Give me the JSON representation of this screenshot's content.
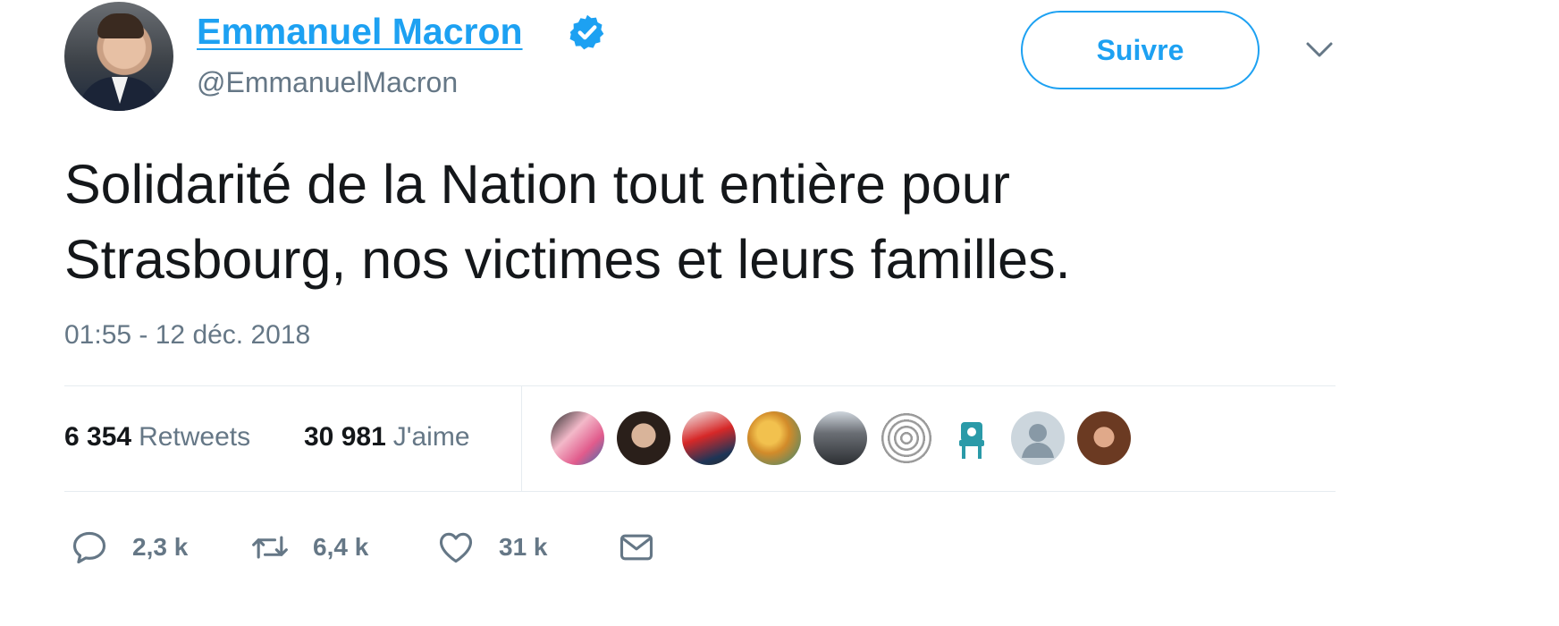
{
  "header": {
    "name": "Emmanuel Macron",
    "handle": "@EmmanuelMacron",
    "follow_label": "Suivre",
    "accent_color": "#1da1f2"
  },
  "tweet": {
    "text_line1": "Solidarité de la Nation tout entière pour",
    "text_line2": "Strasbourg, nos victimes et leurs familles.",
    "timestamp": "01:55 - 12 déc. 2018"
  },
  "stats": {
    "retweets_count": "6 354",
    "retweets_label": "Retweets",
    "likes_count": "30 981",
    "likes_label": "J'aime"
  },
  "likers": [
    "avatar-1",
    "avatar-2",
    "avatar-3",
    "avatar-4",
    "avatar-5",
    "avatar-6",
    "avatar-7",
    "avatar-8",
    "avatar-9"
  ],
  "actions": {
    "reply_count": "2,3 k",
    "retweet_count": "6,4 k",
    "like_count": "31 k"
  },
  "icons": [
    "verified-badge-icon",
    "chevron-down-icon",
    "reply-icon",
    "retweet-icon",
    "heart-icon",
    "mail-icon"
  ]
}
